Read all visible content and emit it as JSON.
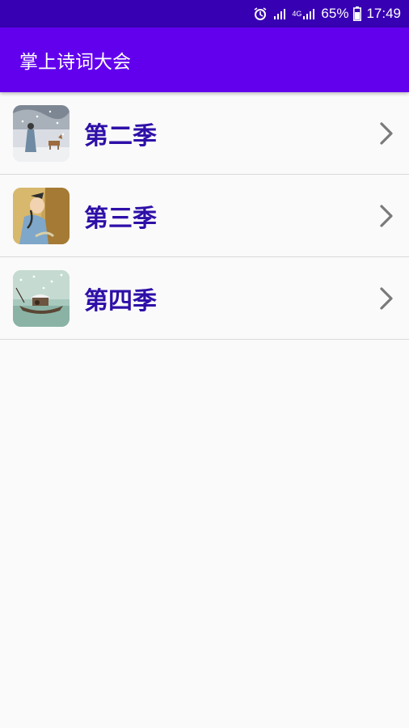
{
  "status_bar": {
    "icons": [
      "alarm-icon",
      "signal-icon",
      "lte-signal-icon",
      "battery-icon"
    ],
    "network_label": "4G",
    "battery": "65%",
    "time": "17:49"
  },
  "app_bar": {
    "title": "掌上诗词大会",
    "background": "#6200ee"
  },
  "seasons": [
    {
      "label": "第二季",
      "icon": "snow-scene-thumbnail"
    },
    {
      "label": "第三季",
      "icon": "poet-thumbnail"
    },
    {
      "label": "第四季",
      "icon": "boat-thumbnail"
    }
  ],
  "colors": {
    "status_bar": "#3700b3",
    "label": "#2e0fa8",
    "chevron": "#7a7a7a"
  }
}
